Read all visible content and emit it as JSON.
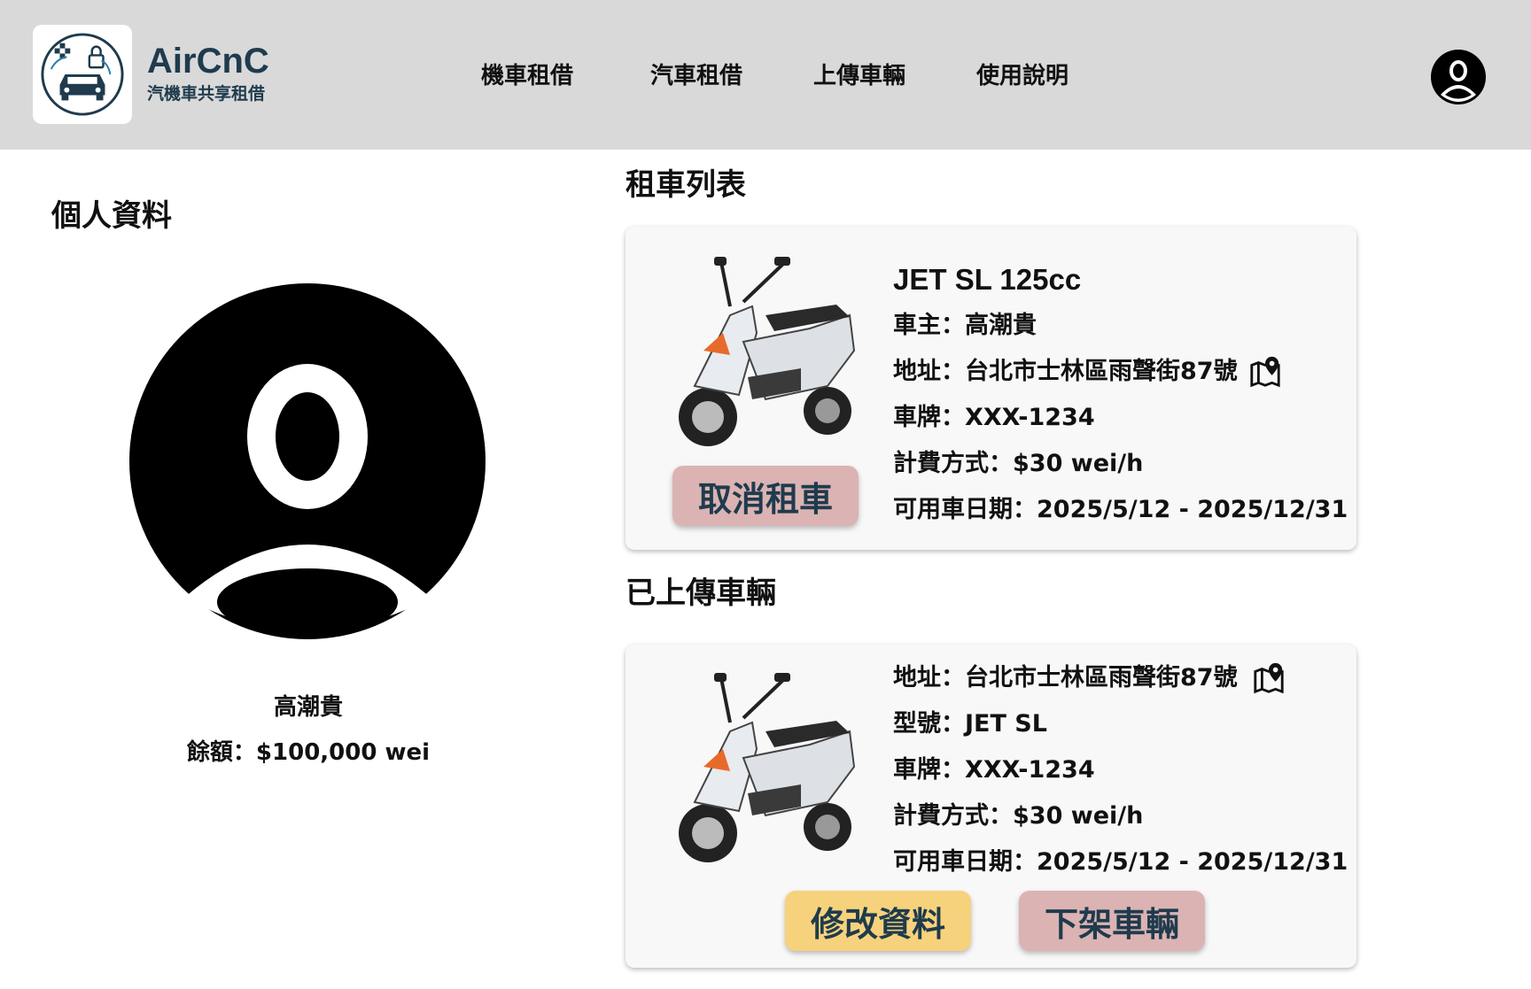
{
  "brand": {
    "title": "AirCnC",
    "subtitle": "汽機車共享租借"
  },
  "nav": {
    "items": [
      "機車租借",
      "汽車租借",
      "上傳車輛",
      "使用說明"
    ]
  },
  "profile": {
    "title": "個人資料",
    "name": "高潮貴",
    "balance": "餘額：$100,000 wei"
  },
  "rentals": {
    "title": "租車列表",
    "items": [
      {
        "model": "JET SL 125cc",
        "owner": "車主：高潮貴",
        "address": "地址：台北市士林區雨聲街87號",
        "plate": "車牌：XXX-1234",
        "price": "計費方式：$30 wei/h",
        "dates": "可用車日期：2025/5/12 - 2025/12/31",
        "cancel_label": "取消租車"
      }
    ]
  },
  "uploads": {
    "title": "已上傳車輛",
    "items": [
      {
        "address": "地址：台北市士林區雨聲街87號",
        "model": "型號：JET SL",
        "plate": "車牌：XXX-1234",
        "price": "計費方式：$30 wei/h",
        "dates": "可用車日期：2025/5/12 - 2025/12/31",
        "edit_label": "修改資料",
        "remove_label": "下架車輛"
      }
    ]
  },
  "colors": {
    "header_bg": "#d9d9d9",
    "brand": "#1f3b4d",
    "cancel_btn": "#dbb3b3",
    "edit_btn": "#f7d27c",
    "remove_btn": "#dbb3b3"
  },
  "icons": {
    "logo": "car-share-logo-icon",
    "user": "user-avatar-icon",
    "map": "map-pin-icon",
    "vehicle": "scooter-image"
  }
}
